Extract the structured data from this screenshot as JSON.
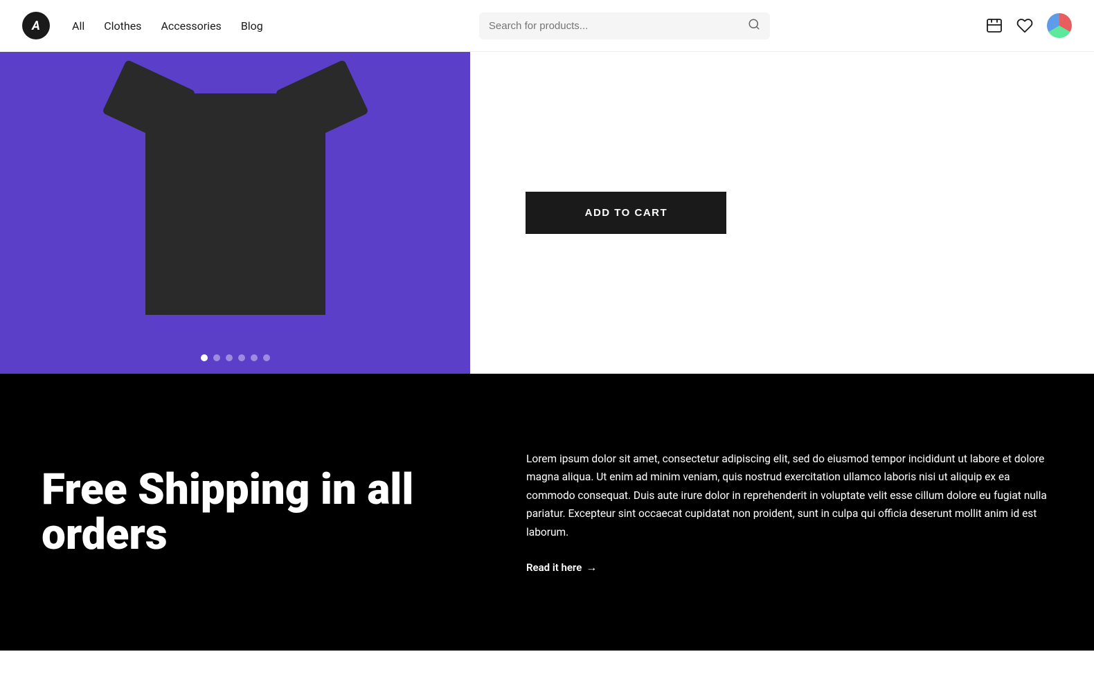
{
  "header": {
    "logo_letter": "A",
    "nav": {
      "all_label": "All",
      "clothes_label": "Clothes",
      "accessories_label": "Accessories",
      "blog_label": "Blog"
    },
    "search": {
      "placeholder": "Search for products..."
    }
  },
  "hero": {
    "add_to_cart_label": "ADD TO CART",
    "carousel_dots": [
      {
        "active": true
      },
      {
        "active": false
      },
      {
        "active": false
      },
      {
        "active": false
      },
      {
        "active": false
      },
      {
        "active": false
      }
    ]
  },
  "shipping": {
    "heading": "Free Shipping in all orders",
    "description": "Lorem ipsum dolor sit amet, consectetur adipiscing elit, sed do eiusmod tempor incididunt ut labore et dolore magna aliqua. Ut enim ad minim veniam, quis nostrud exercitation ullamco laboris nisi ut aliquip ex ea commodo consequat. Duis aute irure dolor in reprehenderit in voluptate velit esse cillum dolore eu fugiat nulla pariatur. Excepteur sint occaecat cupidatat non proident, sunt in culpa qui officia deserunt mollit anim id est laborum.",
    "read_link_label": "Read it here",
    "arrow": "→"
  }
}
